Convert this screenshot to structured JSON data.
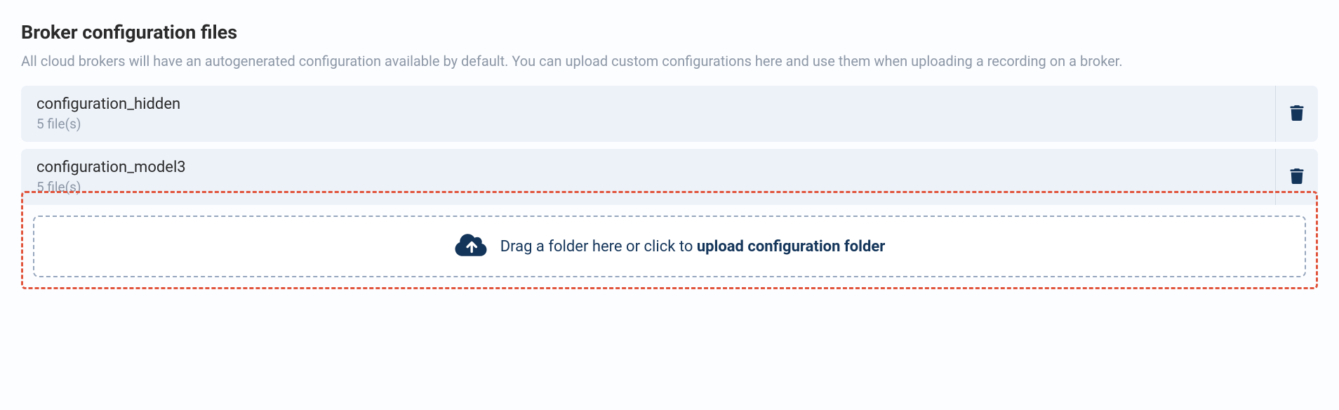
{
  "section": {
    "title": "Broker configuration files",
    "description": "All cloud brokers will have an autogenerated configuration available by default. You can upload custom configurations here and use them when uploading a recording on a broker."
  },
  "configs": [
    {
      "name": "configuration_hidden",
      "count_label": "5 file(s)"
    },
    {
      "name": "configuration_model3",
      "count_label": "5 file(s)"
    }
  ],
  "upload": {
    "text_prefix": "Drag a folder here or click to ",
    "text_bold": "upload configuration folder"
  }
}
